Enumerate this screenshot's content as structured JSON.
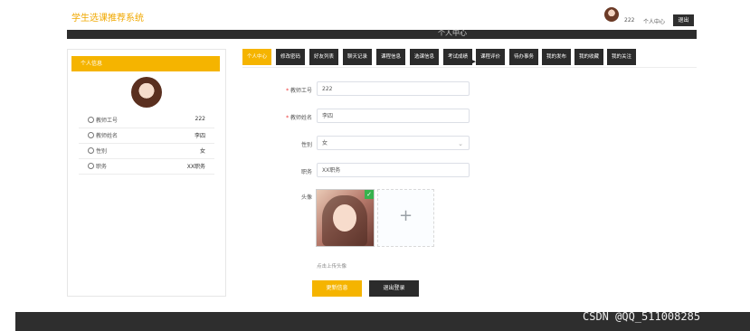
{
  "header": {
    "app_title": "学生选课推荐系统",
    "user_name": "222",
    "user_center": "个人中心",
    "logout": "退出"
  },
  "page_title": "个人中心",
  "left_panel": {
    "title": "个人信息",
    "rows": [
      {
        "label": "教师工号",
        "value": "222"
      },
      {
        "label": "教师姓名",
        "value": "李四"
      },
      {
        "label": "性别",
        "value": "女"
      },
      {
        "label": "职务",
        "value": "XX职务"
      }
    ]
  },
  "tabs": [
    {
      "label": "个人中心",
      "active": true
    },
    {
      "label": "修改密码",
      "active": false
    },
    {
      "label": "好友列表",
      "active": false
    },
    {
      "label": "聊天记录",
      "active": false
    },
    {
      "label": "课程信息",
      "active": false
    },
    {
      "label": "选课信息",
      "active": false
    },
    {
      "label": "考试成绩",
      "active": false
    },
    {
      "label": "课程评价",
      "active": false
    },
    {
      "label": "待办事务",
      "active": false
    },
    {
      "label": "我的发布",
      "active": false
    },
    {
      "label": "我的收藏",
      "active": false
    },
    {
      "label": "我的关注",
      "active": false
    }
  ],
  "form": {
    "teacher_id": {
      "label": "教师工号",
      "value": "222",
      "required": "*"
    },
    "teacher_name": {
      "label": "教师姓名",
      "value": "李四",
      "required": "*"
    },
    "gender": {
      "label": "性别",
      "value": "女"
    },
    "position": {
      "label": "职务",
      "value": "XX职务"
    },
    "avatar": {
      "label": "头像",
      "hint": "点击上传头像"
    }
  },
  "buttons": {
    "update": "更新信息",
    "logout": "退出登录"
  },
  "watermark": "CSDN @QQ_511008285",
  "colors": {
    "accent": "#f5b400",
    "dark": "#2b2b2b"
  }
}
